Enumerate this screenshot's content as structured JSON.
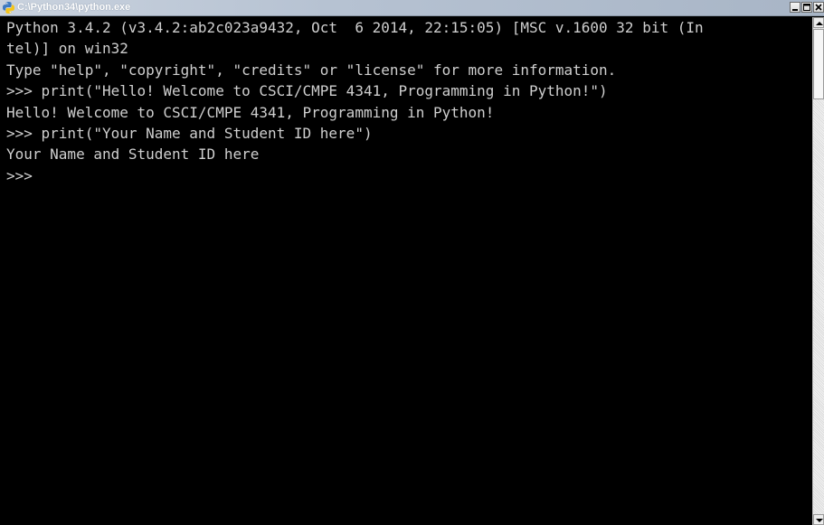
{
  "window": {
    "title": "C:\\Python34\\python.exe",
    "icon": "python-icon",
    "controls": [
      "minimize-icon",
      "maximize-icon",
      "close-icon"
    ]
  },
  "console": {
    "lines": [
      "Python 3.4.2 (v3.4.2:ab2c023a9432, Oct  6 2014, 22:15:05) [MSC v.1600 32 bit (In",
      "tel)] on win32",
      "Type \"help\", \"copyright\", \"credits\" or \"license\" for more information.",
      ">>> print(\"Hello! Welcome to CSCI/CMPE 4341, Programming in Python!\")",
      "Hello! Welcome to CSCI/CMPE 4341, Programming in Python!",
      ">>> print(\"Your Name and Student ID here\")",
      "Your Name and Student ID here",
      ">>>"
    ],
    "colors": {
      "background": "#000000",
      "text": "#cfcfcf"
    }
  },
  "scrollbar": {
    "position": 0.0
  }
}
